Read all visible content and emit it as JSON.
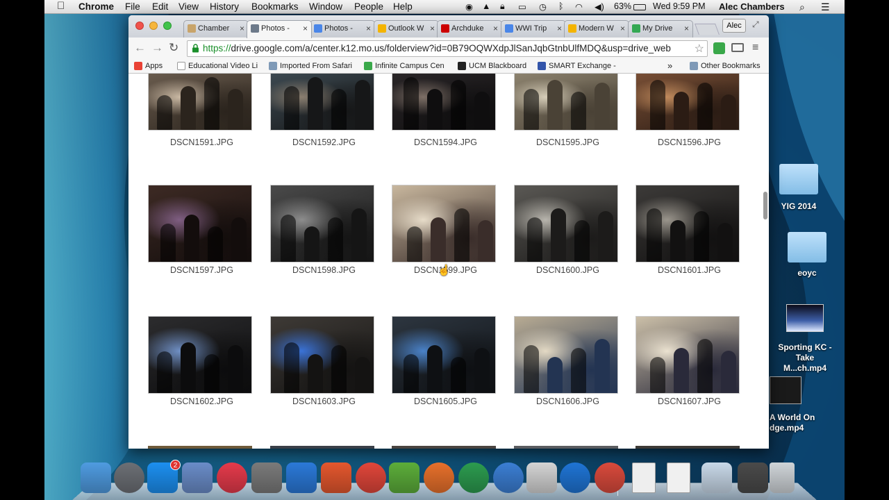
{
  "menubar": {
    "apple": "",
    "app_name": "Chrome",
    "menus": [
      "File",
      "Edit",
      "View",
      "History",
      "Bookmarks",
      "Window",
      "People",
      "Help"
    ],
    "battery": "63%",
    "clock": "Wed 9:59 PM",
    "user": "Alec Chambers"
  },
  "tabs": [
    {
      "label": "Chamber",
      "color": "#c8a46a"
    },
    {
      "label": "Photos - ",
      "color": "#6d7a8a",
      "active": true
    },
    {
      "label": "Photos - ",
      "color": "#4a86e8"
    },
    {
      "label": "Outlook W",
      "color": "#f4b400"
    },
    {
      "label": "Archduke",
      "color": "#cc0000"
    },
    {
      "label": "WWI Trip",
      "color": "#4a86e8"
    },
    {
      "label": "Modern W",
      "color": "#f4b400"
    },
    {
      "label": "My Drive",
      "color": "#34a853"
    }
  ],
  "profile_label": "Alec",
  "toolbar": {
    "url_scheme": "https://",
    "url_rest": "drive.google.com/a/center.k12.mo.us/folderview?id=0B79OQWXdpJlSanJqbGtnbUlfMDQ&usp=drive_web"
  },
  "bookmarks": [
    {
      "label": "Apps",
      "color": "#e94235"
    },
    {
      "label": "Educational Video Li",
      "color": "#ffffff"
    },
    {
      "label": "Imported From Safari",
      "color": "#7f9ab7"
    },
    {
      "label": "Infinite Campus Cen",
      "color": "#3aa84a"
    },
    {
      "label": "UCM Blackboard",
      "color": "#222222"
    },
    {
      "label": "SMART Exchange - ",
      "color": "#3355aa"
    },
    {
      "label": "Other Bookmarks",
      "color": "#7f9ab7"
    }
  ],
  "bookmarks_overflow": "»",
  "photos": [
    {
      "name": "DSCN1591.JPG",
      "palette": [
        "#6b5d4f",
        "#2b241d",
        "#c9b8a3"
      ]
    },
    {
      "name": "DSCN1592.JPG",
      "palette": [
        "#3d4a52",
        "#161718",
        "#8a7e6f"
      ]
    },
    {
      "name": "DSCN1594.JPG",
      "palette": [
        "#2a2628",
        "#0f0e0f",
        "#7d6f66"
      ]
    },
    {
      "name": "DSCN1595.JPG",
      "palette": [
        "#8e8470",
        "#4a4236",
        "#d6cdb8"
      ]
    },
    {
      "name": "DSCN1596.JPG",
      "palette": [
        "#7a5036",
        "#2b1c14",
        "#c08a5c"
      ]
    },
    {
      "name": "DSCN1597.JPG",
      "palette": [
        "#3d2a24",
        "#130d0c",
        "#7f5e82"
      ]
    },
    {
      "name": "DSCN1598.JPG",
      "palette": [
        "#4a4a4a",
        "#151515",
        "#8d8d8d"
      ]
    },
    {
      "name": "DSCN1599.JPG",
      "palette": [
        "#c8b79e",
        "#3a2d2a",
        "#e7dcc9"
      ]
    },
    {
      "name": "DSCN1600.JPG",
      "palette": [
        "#5a5854",
        "#1c1b1a",
        "#b8b5ad"
      ]
    },
    {
      "name": "DSCN1601.JPG",
      "palette": [
        "#3c3a38",
        "#121111",
        "#9a958c"
      ]
    },
    {
      "name": "DSCN1602.JPG",
      "palette": [
        "#2c2c2e",
        "#0c0c0d",
        "#6f8fc4"
      ]
    },
    {
      "name": "DSCN1603.JPG",
      "palette": [
        "#3e3a36",
        "#141312",
        "#3a72d6"
      ]
    },
    {
      "name": "DSCN1605.JPG",
      "palette": [
        "#2d3640",
        "#0e1013",
        "#4a82c8"
      ]
    },
    {
      "name": "DSCN1606.JPG",
      "palette": [
        "#b8ab93",
        "#233452",
        "#e3d9c4"
      ]
    },
    {
      "name": "DSCN1607.JPG",
      "palette": [
        "#cbbfa8",
        "#2a2a3a",
        "#ebe2d0"
      ]
    }
  ],
  "desktop": [
    {
      "label": "YIG 2014"
    },
    {
      "label": "eoyc"
    },
    {
      "label": "Sporting KC -\nTake M...ch.mp4"
    },
    {
      "label": "A World On\ndge.mp4"
    }
  ],
  "dock": [
    {
      "name": "finder-icon",
      "color": "#4f9be0"
    },
    {
      "name": "launchpad-icon",
      "color": "#6c6f75"
    },
    {
      "name": "app-store-icon",
      "color": "#1c8ff0",
      "badge": "2"
    },
    {
      "name": "preview-icon",
      "color": "#6a8cc8"
    },
    {
      "name": "itunes-icon",
      "color": "#e53a4b"
    },
    {
      "name": "system-preferences-icon",
      "color": "#7a7a7a"
    },
    {
      "name": "word-icon",
      "color": "#2b79d8"
    },
    {
      "name": "powerpoint-icon",
      "color": "#e4572e"
    },
    {
      "name": "chrome-icon",
      "color": "#e0463a"
    },
    {
      "name": "evernote-icon",
      "color": "#5cad3a"
    },
    {
      "name": "firefox-icon",
      "color": "#e7702b"
    },
    {
      "name": "google-drive-icon",
      "color": "#2c9b4f"
    },
    {
      "name": "quicktime-icon",
      "color": "#3b7ed3"
    },
    {
      "name": "grab-icon",
      "color": "#d4d4d4"
    },
    {
      "name": "youtube-icon",
      "color": "#1f74d4"
    },
    {
      "name": "chrome-app-icon",
      "color": "#d94a3c"
    },
    {
      "name": "xlsx-file-icon",
      "color": "#eeeeee"
    },
    {
      "name": "pdf-file-icon",
      "color": "#f0f0f0"
    },
    {
      "name": "window-thumbnail-icon",
      "color": "#c8d8e8"
    },
    {
      "name": "screen-thumbnail-icon",
      "color": "#4a4a4a"
    },
    {
      "name": "trash-icon",
      "color": "#cfd4d8"
    }
  ]
}
